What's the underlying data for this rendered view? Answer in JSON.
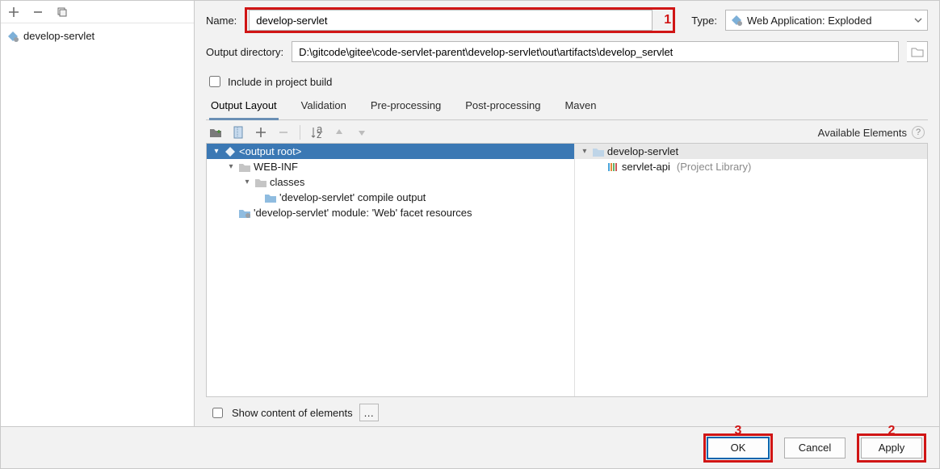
{
  "sidebar": {
    "items": [
      {
        "label": "develop-servlet"
      }
    ]
  },
  "form": {
    "name_label": "Name:",
    "name_value": "develop-servlet",
    "type_label": "Type:",
    "type_value": "Web Application: Exploded",
    "outdir_label": "Output directory:",
    "outdir_value": "D:\\gitcode\\gitee\\code-servlet-parent\\develop-servlet\\out\\artifacts\\develop_servlet",
    "include_label": "Include in project build"
  },
  "tabs": {
    "output_layout": "Output Layout",
    "validation": "Validation",
    "preprocessing": "Pre-processing",
    "postprocessing": "Post-processing",
    "maven": "Maven"
  },
  "available_header": "Available Elements",
  "left_tree": {
    "root": "<output root>",
    "webinf": "WEB-INF",
    "classes": "classes",
    "compile_out": "'develop-servlet' compile output",
    "facet": "'develop-servlet' module: 'Web' facet resources"
  },
  "right_tree": {
    "root": "develop-servlet",
    "lib": "servlet-api",
    "lib_suffix": "(Project Library)"
  },
  "show_content_label": "Show content of elements",
  "annotations": {
    "one": "1",
    "two": "2",
    "three": "3"
  },
  "buttons": {
    "ok": "OK",
    "cancel": "Cancel",
    "apply": "Apply"
  }
}
